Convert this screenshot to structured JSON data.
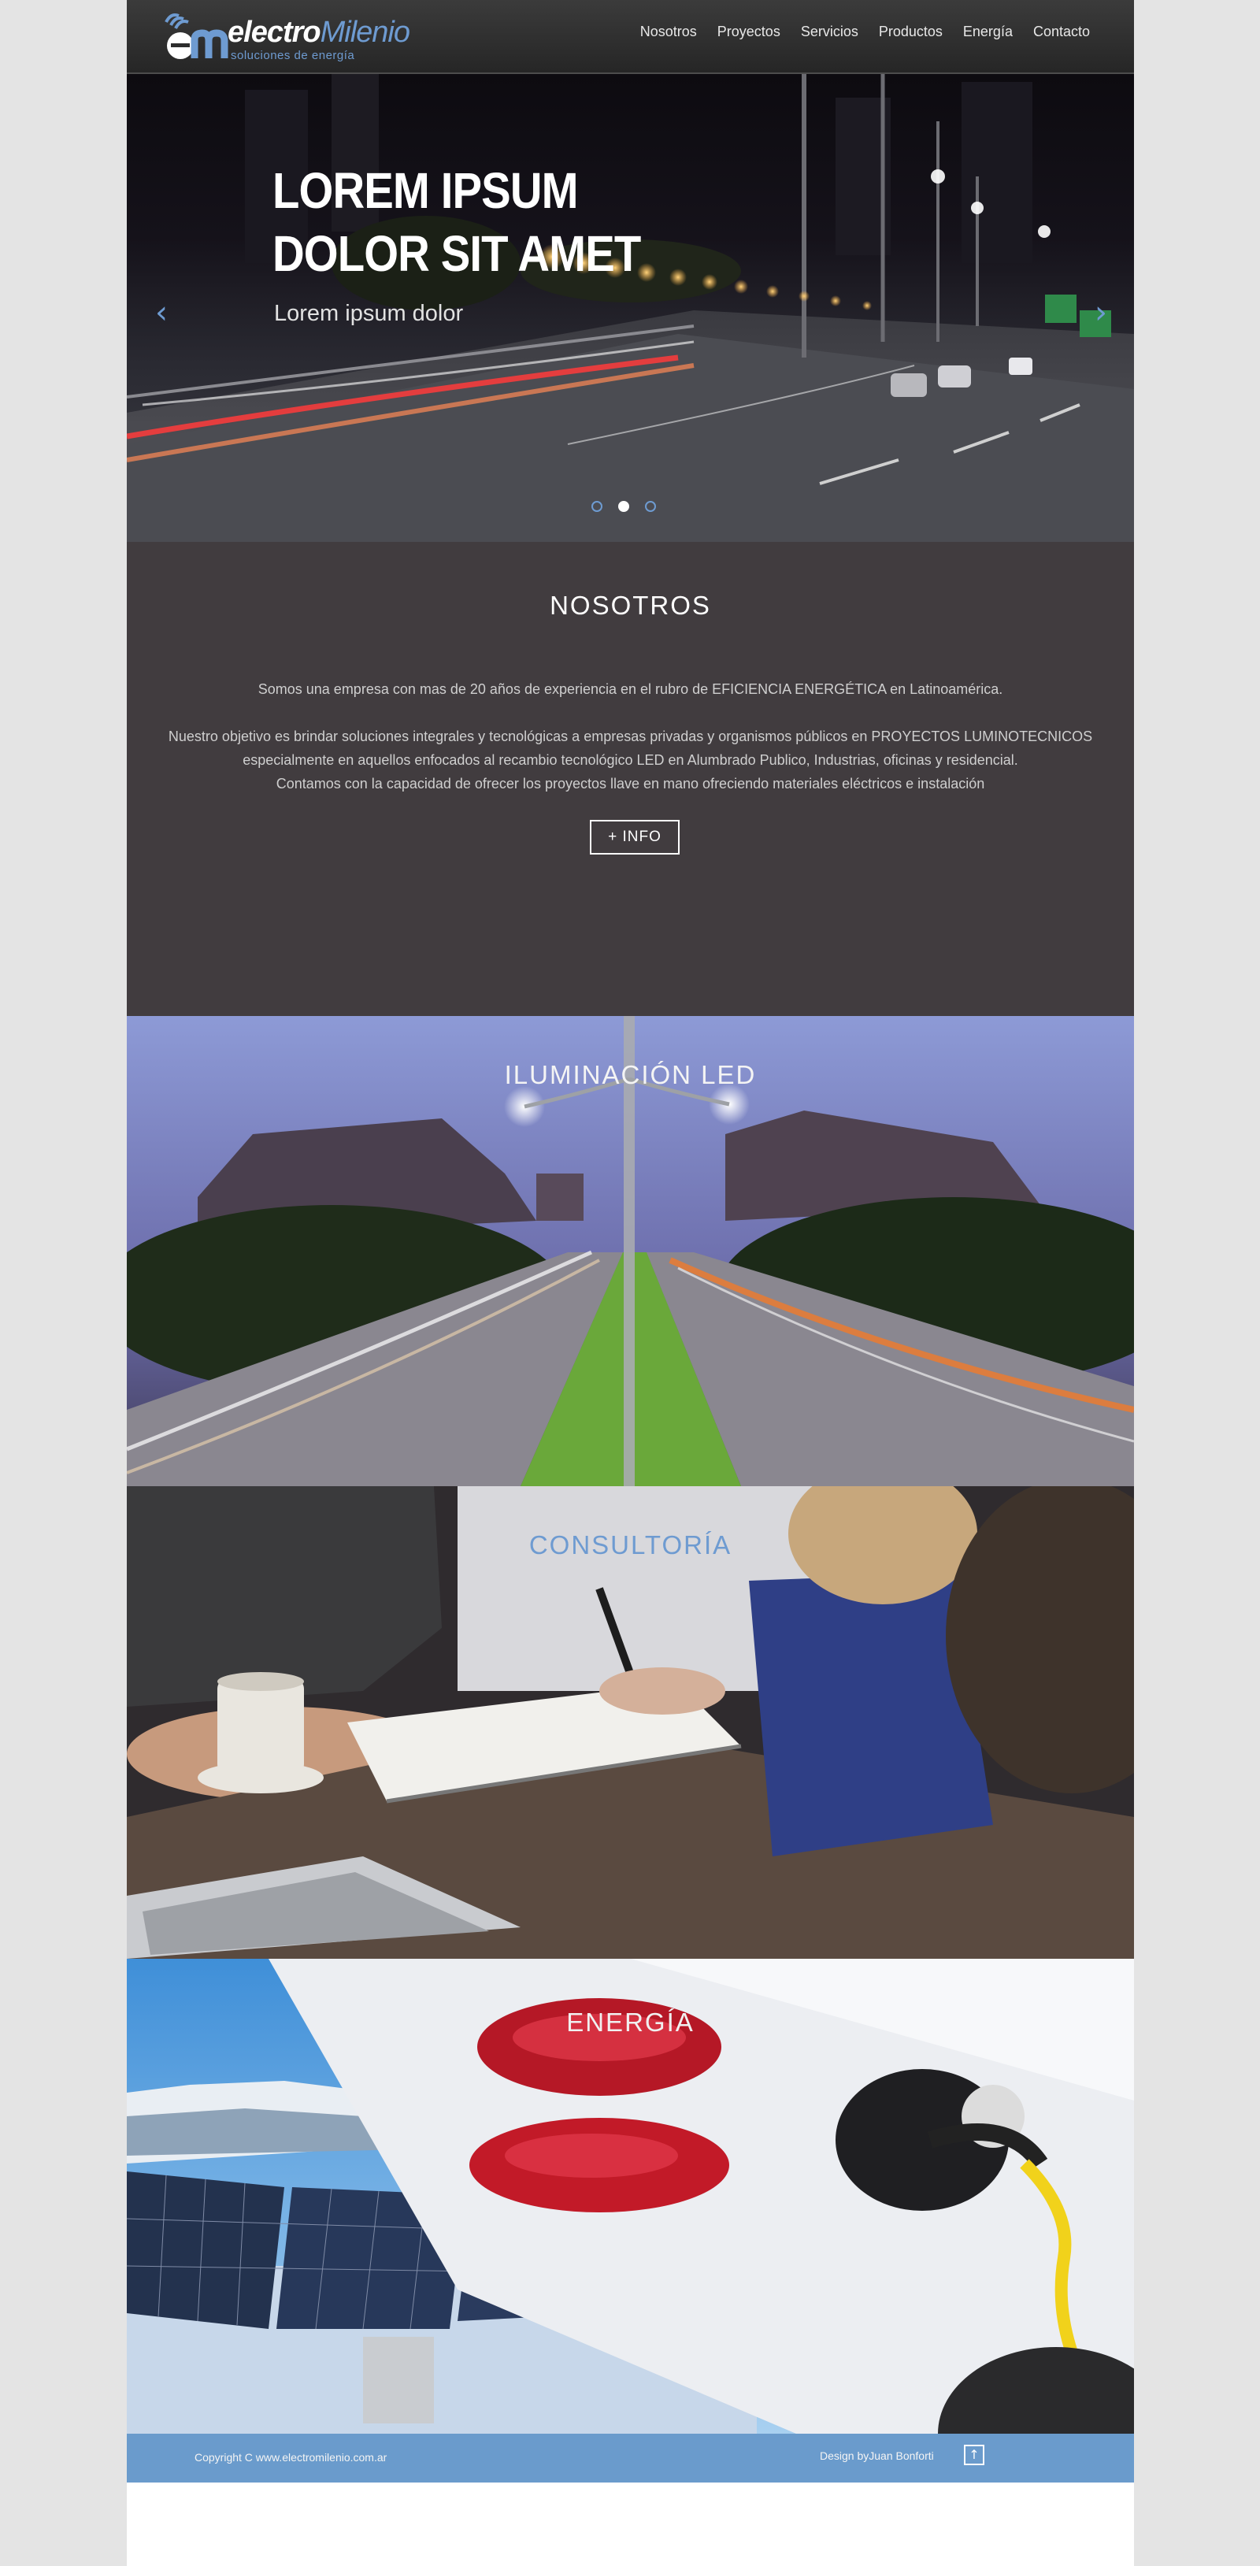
{
  "brand": {
    "name_bold": "electro",
    "name_light": "Milenio",
    "tagline": "soluciones de energía"
  },
  "nav": {
    "items": [
      {
        "label": "Nosotros"
      },
      {
        "label": "Proyectos"
      },
      {
        "label": "Servicios"
      },
      {
        "label": "Productos"
      },
      {
        "label": "Energía"
      },
      {
        "label": "Contacto"
      }
    ]
  },
  "hero": {
    "title": "LOREM IPSUM DOLOR SIT AMET",
    "subtitle": "Lorem ipsum dolor",
    "prev_icon": "chevron-left-icon",
    "next_icon": "chevron-right-icon",
    "slides": 3,
    "active_slide": 2
  },
  "nosotros": {
    "title": "NOSOTROS",
    "paragraph1": "Somos una empresa con mas de 20 años de experiencia en el rubro de EFICIENCIA ENERGÉTICA en Latinoamérica.",
    "paragraph2_line1": "Nuestro objetivo es brindar soluciones integrales y tecnológicas a empresas privadas y organismos públicos en PROYECTOS LUMINOTECNICOS",
    "paragraph2_line2": "especialmente en aquellos enfocados al recambio tecnológico LED en Alumbrado Publico, Industrias, oficinas y residencial.",
    "paragraph2_line3": "Contamos con la capacidad de ofrecer los proyectos llave en mano ofreciendo materiales eléctricos e instalación",
    "button": "+ INFO"
  },
  "sections": {
    "led": "ILUMINACIÓN LED",
    "consultoria": "CONSULTORÍA",
    "energia": "ENERGÍA"
  },
  "footer": {
    "copyright": "Copyright C  www.electromilenio.com.ar",
    "design": "Design byJuan Bonforti",
    "up_icon": "arrow-up-icon"
  },
  "colors": {
    "accent": "#6e9bd1",
    "dark_section": "#413c3f",
    "footer": "#6a9bcc"
  }
}
